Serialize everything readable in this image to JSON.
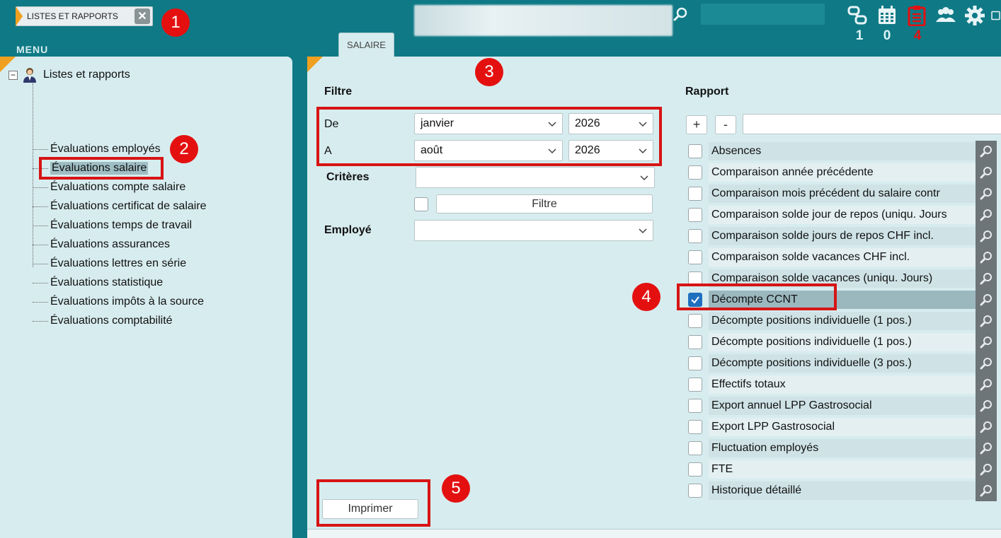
{
  "header": {
    "app_tab_label": "LISTES ET RAPPORTS",
    "menu_label": "MENU",
    "module_tab_label": "SALAIRE",
    "notifications": [
      {
        "icon": "connections-icon",
        "count": "1"
      },
      {
        "icon": "calendar-icon",
        "count": "0"
      },
      {
        "icon": "clipboard-icon",
        "count": "4"
      }
    ]
  },
  "badges": [
    "1",
    "2",
    "3",
    "4",
    "5"
  ],
  "sidebar": {
    "root_label": "Listes et rapports",
    "items": [
      {
        "label": "Évaluations employés"
      },
      {
        "label": "Évaluations salaire"
      },
      {
        "label": "Évaluations compte salaire"
      },
      {
        "label": "Évaluations certificat de salaire"
      },
      {
        "label": "Évaluations temps de travail"
      },
      {
        "label": "Évaluations assurances"
      },
      {
        "label": "Évaluations lettres en série"
      },
      {
        "label": "Évaluations statistique"
      },
      {
        "label": "Évaluations impôts à la source"
      },
      {
        "label": "Évaluations comptabilité"
      }
    ],
    "selected_index": 1
  },
  "filter": {
    "title": "Filtre",
    "from_label": "De",
    "from_month": "janvier",
    "from_year": "2026",
    "to_label": "A",
    "to_month": "août",
    "to_year": "2026",
    "criteria_label": "Critères",
    "criteria_value": "",
    "filter_button": "Filtre",
    "employee_label": "Employé",
    "employee_value": "",
    "print_button": "Imprimer"
  },
  "report": {
    "title": "Rapport",
    "add_button": "+",
    "remove_button": "-",
    "search_value": "",
    "rows": [
      {
        "label": "Absences",
        "checked": false
      },
      {
        "label": "Comparaison année précédente",
        "checked": false
      },
      {
        "label": "Comparaison mois précédent du salaire contr",
        "checked": false
      },
      {
        "label": "Comparaison solde jour de repos (uniqu. Jours",
        "checked": false
      },
      {
        "label": "Comparaison solde jours de repos CHF incl.",
        "checked": false
      },
      {
        "label": "Comparaison solde vacances CHF incl.",
        "checked": false
      },
      {
        "label": "Comparaison solde vacances (uniqu. Jours)",
        "checked": false
      },
      {
        "label": "Décompte CCNT",
        "checked": true
      },
      {
        "label": "Décompte positions individuelle (1 pos.)",
        "checked": false
      },
      {
        "label": "Décompte positions individuelle (1 pos.)",
        "checked": false
      },
      {
        "label": "Décompte positions individuelle (3 pos.)",
        "checked": false
      },
      {
        "label": "Effectifs totaux",
        "checked": false
      },
      {
        "label": "Export annuel LPP Gastrosocial",
        "checked": false
      },
      {
        "label": "Export LPP Gastrosocial",
        "checked": false
      },
      {
        "label": "Fluctuation employés",
        "checked": false
      },
      {
        "label": "FTE",
        "checked": false
      },
      {
        "label": "Historique détaillé",
        "checked": false
      }
    ]
  },
  "colors": {
    "header_bg": "#0f7a86",
    "panel_bg": "#d7ecef",
    "accent_orange": "#f0a020",
    "annotation_red": "#d71414",
    "checkbox_blue": "#1f6fbf"
  }
}
